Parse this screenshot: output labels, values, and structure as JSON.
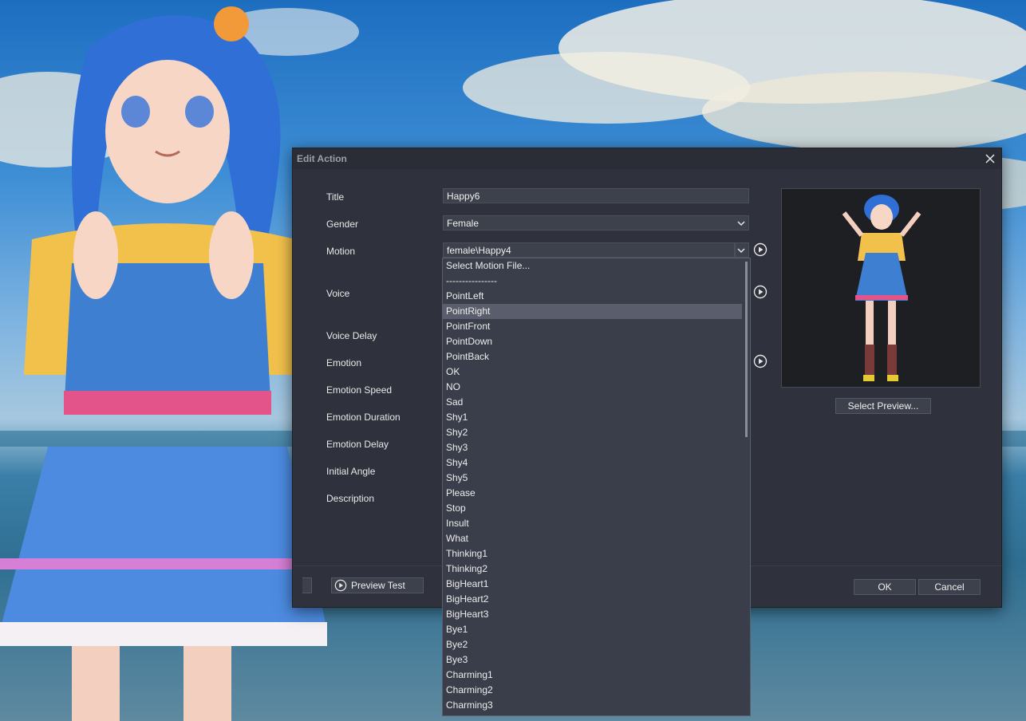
{
  "dialog": {
    "title": "Edit Action",
    "fields": {
      "title_label": "Title",
      "title_value": "Happy6",
      "gender_label": "Gender",
      "gender_value": "Female",
      "motion_label": "Motion",
      "motion_value": "female\\Happy4",
      "voice_label": "Voice",
      "voice_delay_label": "Voice Delay",
      "emotion_label": "Emotion",
      "emotion_speed_label": "Emotion Speed",
      "emotion_duration_label": "Emotion Duration",
      "emotion_delay_label": "Emotion Delay",
      "initial_angle_label": "Initial Angle",
      "description_label": "Description"
    },
    "select_preview_label": "Select Preview...",
    "preview_test_label": "Preview Test",
    "ok_label": "OK",
    "cancel_label": "Cancel"
  },
  "motion_dropdown": {
    "selected_index": 3,
    "items": [
      "Select Motion File...",
      "----------------",
      "PointLeft",
      "PointRight",
      "PointFront",
      "PointDown",
      "PointBack",
      "OK",
      "NO",
      "Sad",
      "Shy1",
      "Shy2",
      "Shy3",
      "Shy4",
      "Shy5",
      "Please",
      "Stop",
      "Insult",
      "What",
      "Thinking1",
      "Thinking2",
      "BigHeart1",
      "BigHeart2",
      "BigHeart3",
      "Bye1",
      "Bye2",
      "Bye3",
      "Charming1",
      "Charming2",
      "Charming3"
    ]
  },
  "icons": {
    "close": "close-icon",
    "combo_arrow": "chevron-down-icon",
    "play": "play-circle-icon"
  },
  "colors": {
    "dialog_bg": "#2f323c",
    "field_bg": "#3d414c",
    "selected_item": "#5a5e6c"
  }
}
